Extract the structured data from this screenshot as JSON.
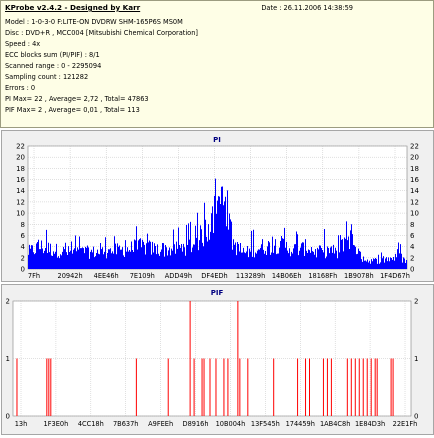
{
  "header": {
    "title": "KProbe v2.4.2 - Designed by Karr",
    "date": "Date : 26.11.2006 14:38:59",
    "lines": [
      "Model : 1-0-3-0 F:LITE-ON DVDRW SHM-165P6S MS0M",
      "Disc : DVD+R , MCC004 [Mitsubishi Chemical Corporation]",
      "Speed : 4x",
      "ECC blocks sum (PI/PIF) : 8/1",
      "Scanned range : 0 - 2295094",
      "Sampling count : 121282",
      "Errors : 0",
      "PI Max= 22 , Average= 2,72 , Total= 47863",
      "PIF Max= 2 , Average= 0,01 , Total= 113"
    ]
  },
  "chart_data": [
    {
      "type": "area",
      "title": "PI",
      "xlabel": "",
      "ylabel": "",
      "ylim": [
        0,
        22
      ],
      "yticks": [
        0,
        2,
        4,
        6,
        8,
        10,
        12,
        14,
        16,
        18,
        20,
        22
      ],
      "x_tick_labels": [
        "7Fh",
        "20942h",
        "4EE46h",
        "7E109h",
        "ADD49h",
        "DF4EDh",
        "113289h",
        "14B06Eh",
        "18168Fh",
        "1B9078h",
        "1F4D67h"
      ],
      "grid": true,
      "color": "#0000ff",
      "envelope": {
        "x": [
          0,
          0.03,
          0.06,
          0.1,
          0.14,
          0.18,
          0.22,
          0.26,
          0.3,
          0.34,
          0.38,
          0.42,
          0.44,
          0.46,
          0.48,
          0.5,
          0.52,
          0.54,
          0.56,
          0.58,
          0.6,
          0.62,
          0.64,
          0.66,
          0.68,
          0.7,
          0.72,
          0.74,
          0.76,
          0.78,
          0.8,
          0.82,
          0.84,
          0.86,
          0.88,
          0.9,
          0.92,
          0.94,
          0.96,
          0.98,
          1.0
        ],
        "max": [
          5,
          7,
          7,
          6,
          6,
          6,
          6,
          7,
          8,
          7,
          7,
          8,
          9,
          12,
          15,
          20,
          22,
          11,
          6,
          7,
          8,
          9,
          8,
          10,
          8,
          7,
          8,
          9,
          7,
          7,
          8,
          6,
          11,
          9,
          5,
          4,
          4,
          3,
          5,
          5,
          4
        ],
        "avg": [
          3,
          4,
          3.5,
          3,
          3,
          3,
          3.2,
          3.5,
          4,
          3.5,
          3.5,
          4,
          4.5,
          6,
          8,
          11,
          13,
          5,
          3,
          3,
          3.5,
          4,
          4,
          4.5,
          4,
          3.5,
          3.5,
          4,
          3,
          3,
          3.5,
          2.5,
          6,
          5,
          2,
          1.5,
          1.5,
          1.5,
          2,
          2,
          1.5
        ]
      }
    },
    {
      "type": "bar",
      "title": "PIF",
      "xlabel": "",
      "ylabel": "",
      "ylim": [
        0,
        2
      ],
      "yticks": [
        0,
        1,
        2
      ],
      "x_tick_labels": [
        "13h",
        "1F3E0h",
        "4CC18h",
        "7B637h",
        "A9FEEh",
        "D8916h",
        "10B004h",
        "13F545h",
        "174459h",
        "1AB4C8h",
        "1E84D3h",
        "22E1Fh"
      ],
      "grid": true,
      "color": "#ff0000",
      "x": [
        0.01,
        0.085,
        0.09,
        0.095,
        0.31,
        0.39,
        0.445,
        0.455,
        0.475,
        0.48,
        0.495,
        0.51,
        0.53,
        0.54,
        0.565,
        0.57,
        0.59,
        0.655,
        0.715,
        0.735,
        0.745,
        0.78,
        0.79,
        0.8,
        0.84,
        0.85,
        0.86,
        0.87,
        0.88,
        0.89,
        0.9,
        0.91,
        0.915,
        0.95,
        0.955
      ],
      "values": [
        1,
        1,
        1,
        1,
        1,
        1,
        2,
        1,
        1,
        1,
        1,
        1,
        1,
        1,
        2,
        1,
        1,
        1,
        1,
        1,
        1,
        1,
        1,
        1,
        1,
        1,
        1,
        1,
        1,
        1,
        1,
        1,
        1,
        1,
        1
      ]
    }
  ]
}
